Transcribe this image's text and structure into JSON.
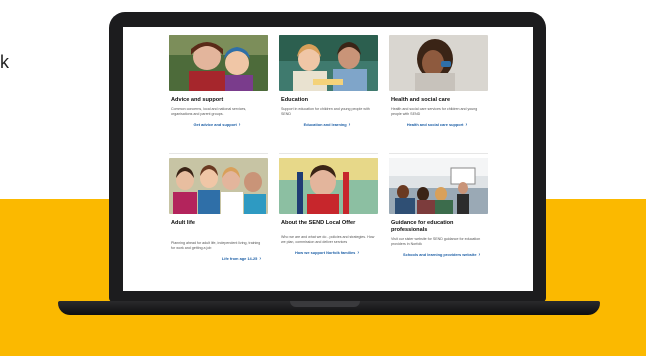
{
  "page": {
    "edge_text": "k",
    "colors": {
      "band": "#fbb900",
      "link": "#1d5fa6",
      "laptop": "#1c1c1e"
    }
  },
  "cards": [
    {
      "title": "Advice and support",
      "desc": "Common concerns, local and national services, organisations and parent groups.",
      "link": "Get advice and support",
      "image": "parent-and-child-photo"
    },
    {
      "title": "Education",
      "desc": "Support in education for children and young people with SEND",
      "link": "Education and learning",
      "image": "classroom-photo"
    },
    {
      "title": "Health and social care",
      "desc": "Health and social care services for children and young people with SEND",
      "link": "Health and social care support",
      "image": "child-inhaler-photo"
    },
    {
      "title": "Adult life",
      "desc": "Planning ahead for adult life, independent living, training for work and getting a job",
      "link": "Life from age 14-25",
      "image": "young-adults-group-photo"
    },
    {
      "title": "About the SEND Local Offer",
      "desc": "Who we are and what we do - policies and strategies. How we plan, commission and deliver services",
      "link": "How we support Norfolk families",
      "image": "boy-wheelchair-photo"
    },
    {
      "title": "Guidance for education professionals",
      "desc": "Visit our sister website for SEND guidance for education providers in Norfolk",
      "link": "Schools and learning providers website",
      "image": "teacher-classroom-photo"
    }
  ]
}
